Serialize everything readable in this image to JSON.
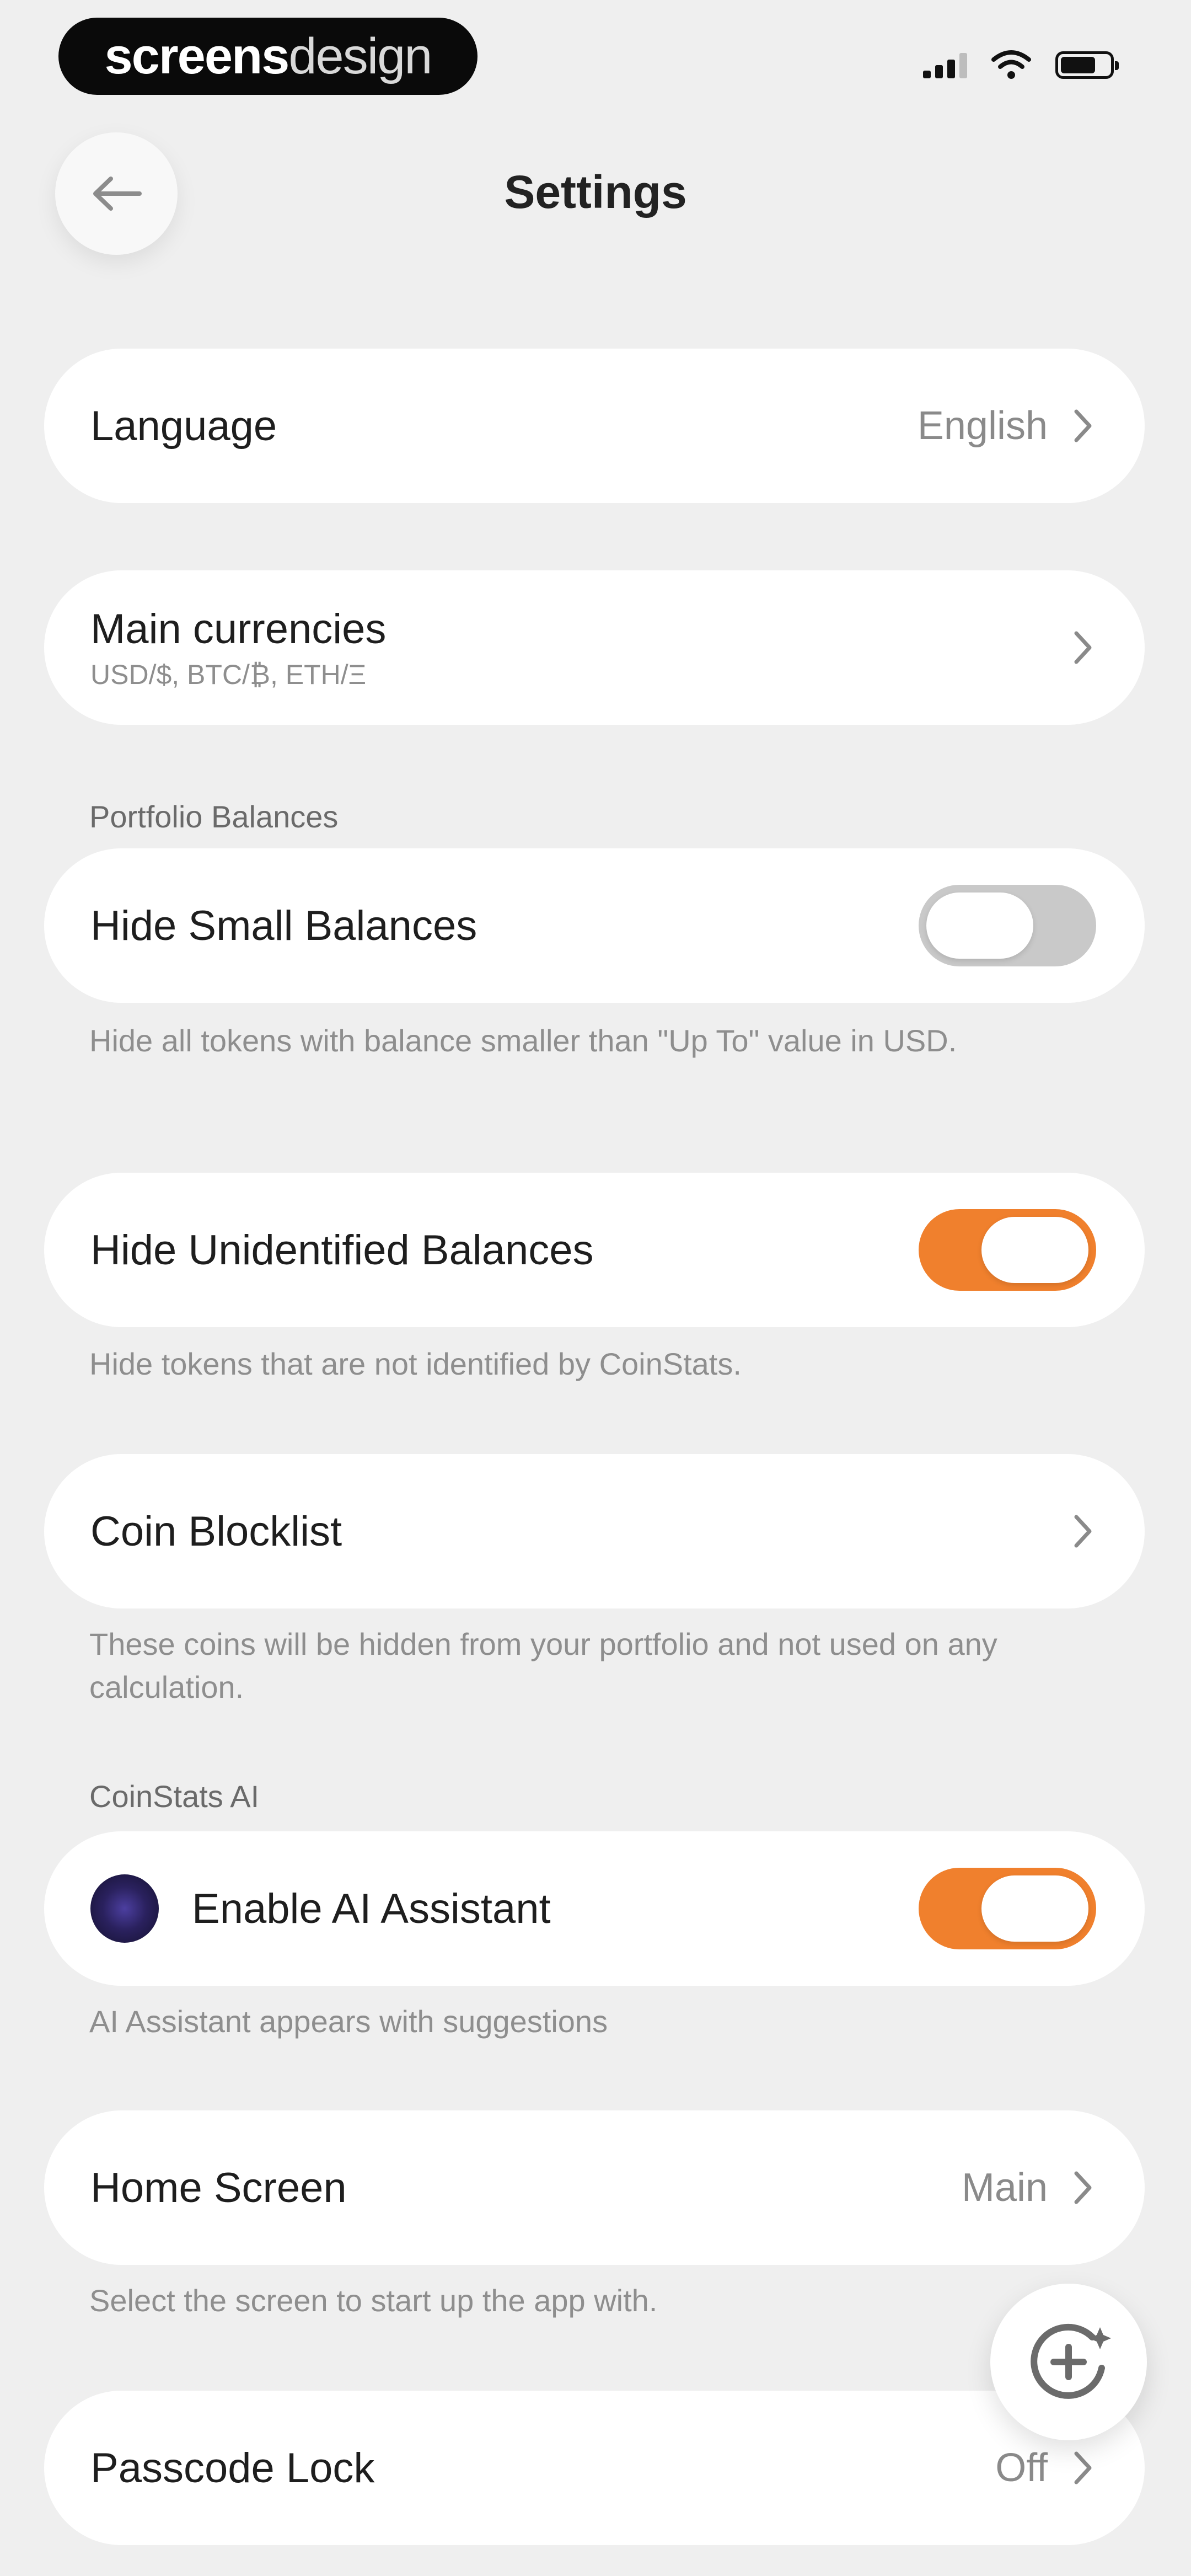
{
  "status_bar": {
    "brand_bold": "screens",
    "brand_light": "design"
  },
  "header": {
    "title": "Settings"
  },
  "rows": {
    "language": {
      "label": "Language",
      "value": "English"
    },
    "main_currencies": {
      "label": "Main currencies",
      "subtitle": "USD/$, BTC/₿, ETH/Ξ"
    },
    "hide_small": {
      "label": "Hide Small Balances",
      "toggle_on": false
    },
    "hide_unidentified": {
      "label": "Hide Unidentified Balances",
      "toggle_on": true
    },
    "coin_blocklist": {
      "label": "Coin Blocklist"
    },
    "ai_assistant": {
      "label": "Enable AI Assistant",
      "toggle_on": true
    },
    "home_screen": {
      "label": "Home Screen",
      "value": "Main"
    },
    "passcode_lock": {
      "label": "Passcode Lock",
      "value": "Off"
    }
  },
  "sections": {
    "portfolio_balances": "Portfolio Balances",
    "coinstats_ai": "CoinStats AI"
  },
  "helpers": {
    "hide_small": "Hide all tokens with balance smaller than \"Up To\" value in USD.",
    "hide_unidentified": "Hide tokens that are not identified by CoinStats.",
    "coin_blocklist": "These coins will be hidden from your portfolio and not used on any calculation.",
    "ai_assistant": "AI Assistant appears with suggestions",
    "home_screen": "Select the screen to start up the app with."
  },
  "colors": {
    "accent": "#f0802d",
    "background": "#efefef",
    "card": "#ffffff",
    "toggle_off": "#c9c9c9"
  },
  "icons": {
    "back": "arrow-left-icon",
    "chevron": "chevron-right-icon",
    "fab": "ai-sparkle-icon"
  }
}
